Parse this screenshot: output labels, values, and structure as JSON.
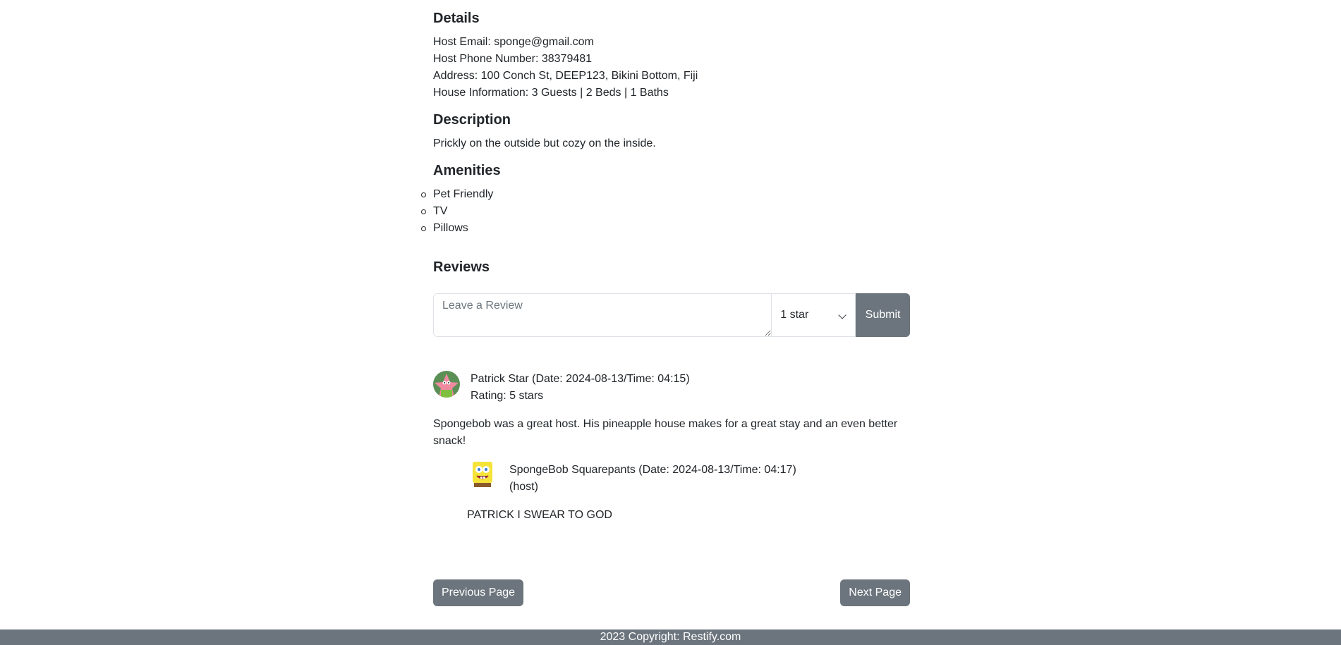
{
  "details": {
    "heading": "Details",
    "host_email": "Host Email: sponge@gmail.com",
    "host_phone": "Host Phone Number: 38379481",
    "address": "Address: 100 Conch St, DEEP123, Bikini Bottom, Fiji",
    "house_info": "House Information: 3 Guests | 2 Beds | 1 Baths"
  },
  "description": {
    "heading": "Description",
    "text": "Prickly on the outside but cozy on the inside."
  },
  "amenities": {
    "heading": "Amenities",
    "items": [
      "Pet Friendly",
      "TV",
      "Pillows"
    ]
  },
  "reviews": {
    "heading": "Reviews",
    "form": {
      "placeholder": "Leave a Review",
      "rating_selected": "1 star",
      "submit_label": "Submit"
    },
    "items": [
      {
        "author_line": "Patrick Star (Date: 2024-08-13/Time: 04:15)",
        "rating": "Rating: 5 stars",
        "body_line1": "Spongebob was a great host. His pineapple house makes for a great stay and an even better",
        "body_line2": "snack!",
        "reply": {
          "author_line": "SpongeBob Squarepants (Date: 2024-08-13/Time: 04:17)",
          "role": "(host)",
          "body": "PATRICK I SWEAR TO GOD"
        }
      }
    ]
  },
  "pagination": {
    "previous_label": "Previous Page",
    "next_label": "Next Page"
  },
  "footer": {
    "copyright": "2023 Copyright: Restify.com"
  },
  "colors": {
    "button_gray": "#6c757d",
    "text": "#212529",
    "border": "#dee2e6"
  }
}
